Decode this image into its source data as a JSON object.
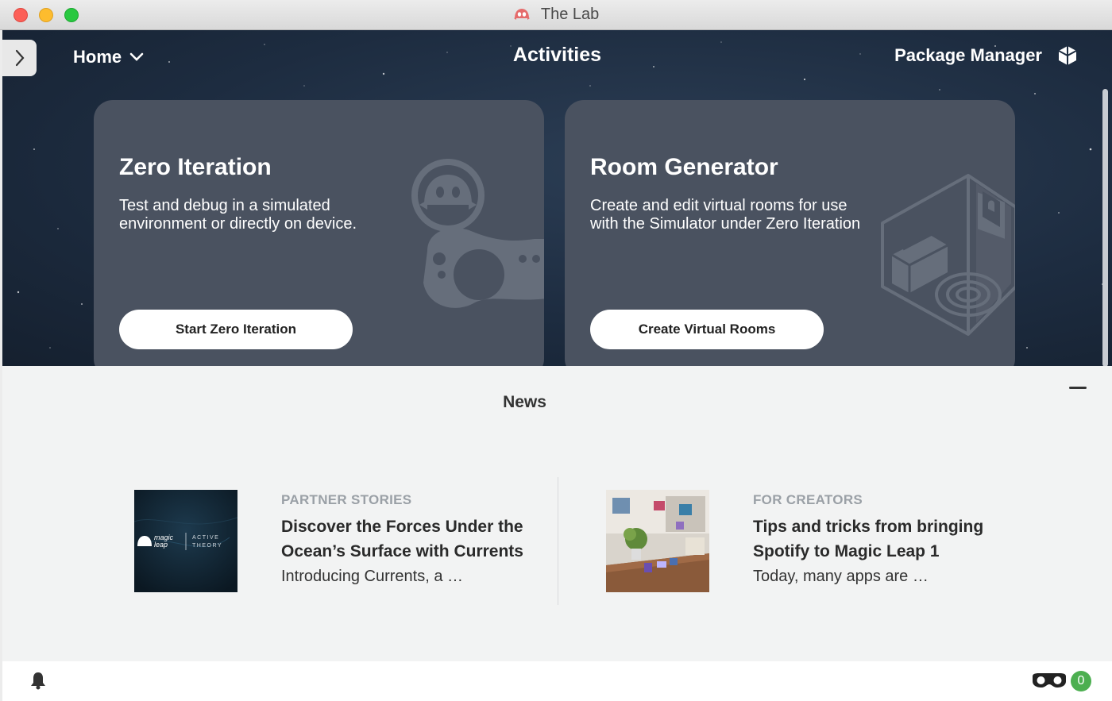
{
  "window": {
    "title": "The Lab"
  },
  "header": {
    "home_label": "Home",
    "center_title": "Activities",
    "package_manager_label": "Package Manager"
  },
  "cards": [
    {
      "title": "Zero Iteration",
      "description": "Test and debug in a simulated environment or directly on device.",
      "button_label": "Start Zero Iteration",
      "icon": "controller-mascot-icon"
    },
    {
      "title": "Room Generator",
      "description": "Create and edit virtual rooms for use with the Simulator under Zero Iteration",
      "button_label": "Create Virtual Rooms",
      "icon": "room-isometric-icon"
    }
  ],
  "news": {
    "title": "News",
    "articles": [
      {
        "category": "PARTNER STORIES",
        "headline": "Discover the Forces Under the Ocean’s Surface with Currents",
        "excerpt": "Introducing Currents, a …",
        "thumb_brand": "magic leap",
        "thumb_partner": "ACTIVE THEORY"
      },
      {
        "category": "FOR CREATORS",
        "headline": "Tips and tricks from bringing Spotify to Magic Leap 1",
        "excerpt": "Today, many apps are …"
      }
    ]
  },
  "footer": {
    "device_count": "0"
  },
  "colors": {
    "accent_green": "#4caf50",
    "card_bg": "#4a5260",
    "hero_bg": "#1d2c40"
  }
}
